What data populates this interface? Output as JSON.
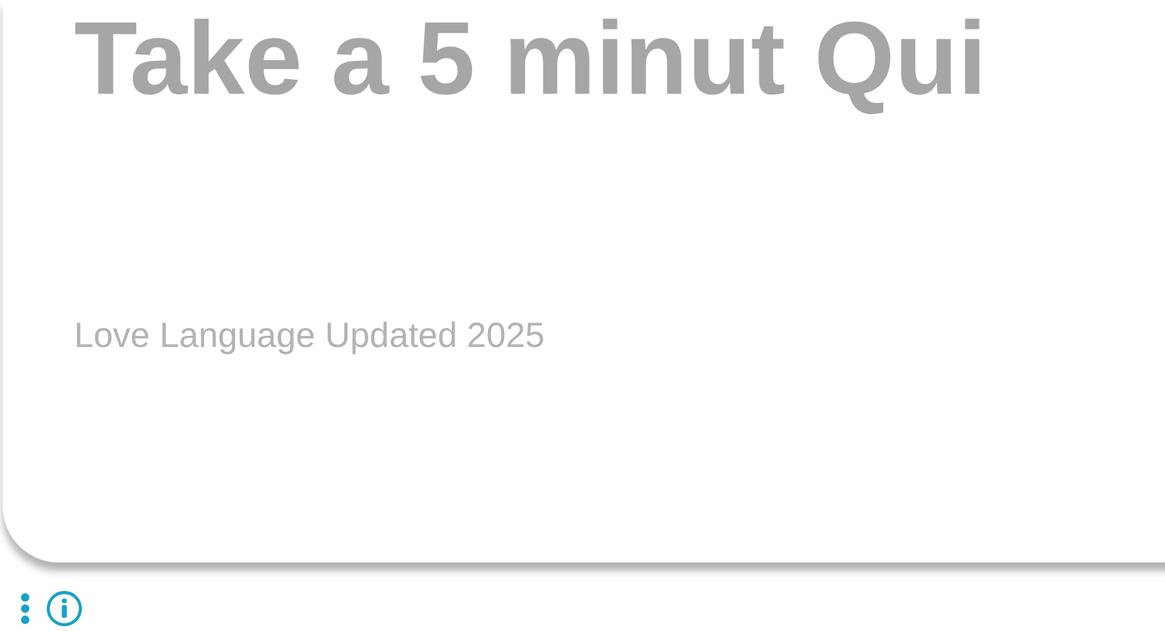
{
  "card": {
    "title": "Take a 5 minut Qui",
    "subtitle": "Love Language Updated 2025"
  }
}
